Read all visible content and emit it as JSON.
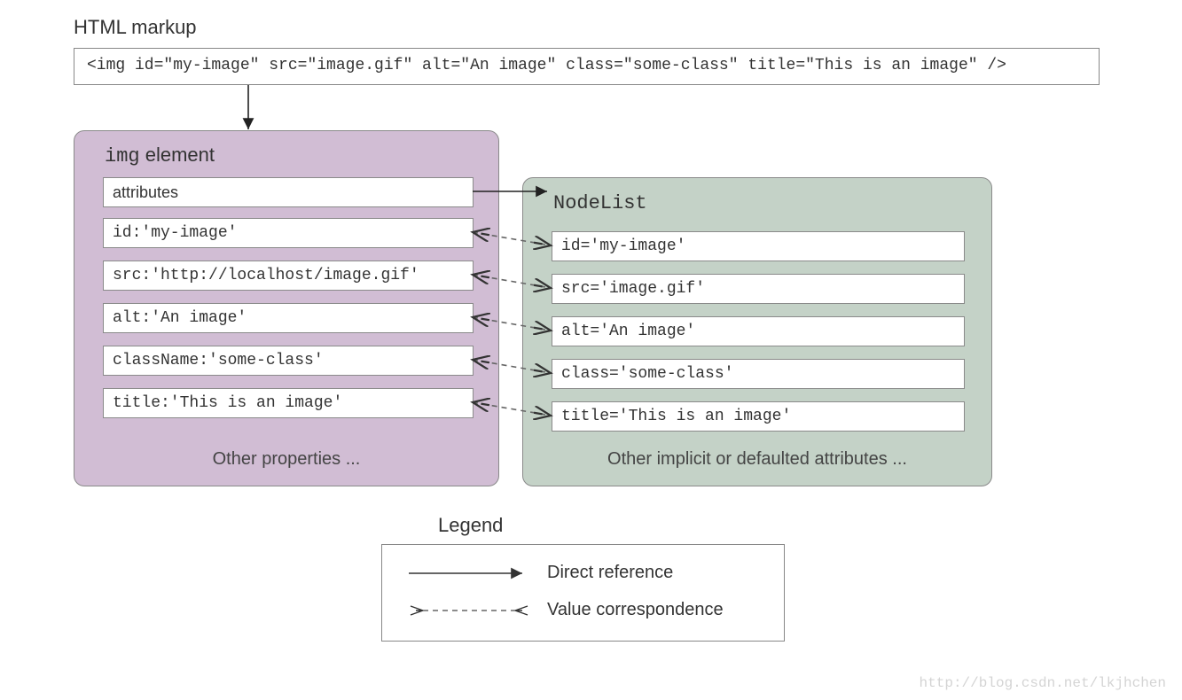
{
  "header": {
    "title": "HTML markup",
    "code": "<img id=\"my-image\" src=\"image.gif\" alt=\"An image\" class=\"some-class\" title=\"This is an image\" />"
  },
  "img_panel": {
    "title_prefix": "img",
    "title_suffix": " element",
    "slots": [
      "attributes",
      "id:'my-image'",
      "src:'http://localhost/image.gif'",
      "alt:'An image'",
      "className:'some-class'",
      "title:'This is an image'"
    ],
    "footer": "Other properties ..."
  },
  "nodelist_panel": {
    "title": "NodeList",
    "slots": [
      "id='my-image'",
      "src='image.gif'",
      "alt='An image'",
      "class='some-class'",
      "title='This is an image'"
    ],
    "footer": "Other implicit or defaulted attributes ..."
  },
  "legend": {
    "title": "Legend",
    "direct": "Direct reference",
    "value_corr": "Value correspondence"
  },
  "watermark": "http://blog.csdn.net/lkjhchen"
}
